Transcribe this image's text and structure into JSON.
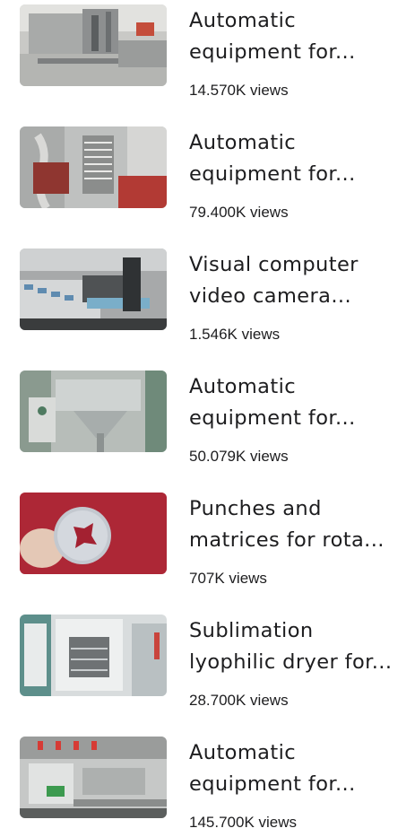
{
  "videos": [
    {
      "title_line1": "Automatic",
      "title_line2": "equipment for...",
      "views": "14.570K views",
      "thumbnail": "machine-conveyor-image"
    },
    {
      "title_line1": "Automatic",
      "title_line2": "equipment for...",
      "views": "79.400K views",
      "thumbnail": "spiral-machine-image"
    },
    {
      "title_line1": "Visual computer",
      "title_line2": "video camera...",
      "views": "1.546K views",
      "thumbnail": "camera-conveyor-image"
    },
    {
      "title_line1": "Automatic",
      "title_line2": "equipment for...",
      "views": "50.079K views",
      "thumbnail": "hopper-machine-image"
    },
    {
      "title_line1": "Punches and",
      "title_line2": "matrices for rota...",
      "views": "707K views",
      "thumbnail": "punch-die-hand-image"
    },
    {
      "title_line1": "Sublimation",
      "title_line2": "lyophilic dryer for...",
      "views": "28.700K views",
      "thumbnail": "freeze-dryer-image"
    },
    {
      "title_line1": "Automatic",
      "title_line2": "equipment for...",
      "views": "145.700K views",
      "thumbnail": "production-line-image"
    }
  ]
}
